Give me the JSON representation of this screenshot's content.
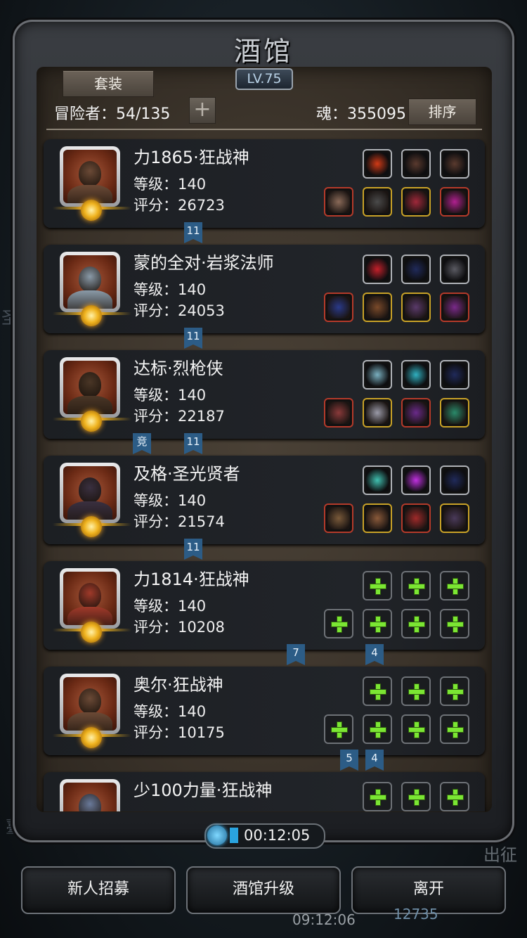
{
  "title": "酒馆",
  "level_badge": "LV.75",
  "suit_button": "套装",
  "adventurer_label": "冒险者：54/135",
  "add_button": "+",
  "soul_label": "魂：355095",
  "sort_button": "排序",
  "heroes": [
    {
      "name": "力1865·狂战神",
      "level": "等级：140",
      "score": "评分：26723",
      "face": "#6b4a36",
      "equip_top": [
        "#d13a16",
        "#5a3a2e",
        "#5a3a2e"
      ],
      "equip_bottom": [
        "#8a6a58",
        "#4a4a4a",
        "#a0283a",
        "#b02090"
      ],
      "borders_bottom": [
        "red",
        "gold",
        "gold",
        "red"
      ],
      "tags": [
        {
          "text": "11"
        }
      ]
    },
    {
      "name": "蒙的全对·岩浆法师",
      "level": "等级：140",
      "score": "评分：24053",
      "face": "#8a9aa8",
      "equip_top": [
        "#c4202a",
        "#202a5a",
        "#5a5a62"
      ],
      "equip_bottom": [
        "#2a3a8a",
        "#7a4a2a",
        "#5a3a6a",
        "#7a2a8a"
      ],
      "borders_bottom": [
        "red",
        "gold",
        "gold",
        "red"
      ],
      "tags": [
        {
          "text": "11"
        }
      ]
    },
    {
      "name": "达标·烈枪侠",
      "level": "等级：140",
      "score": "评分：22187",
      "face": "#4a3626",
      "equip_top": [
        "#7ab0c0",
        "#30b0c0",
        "#202a5a"
      ],
      "equip_bottom": [
        "#8a3a3a",
        "#9a9aa8",
        "#6a2a8a",
        "#2a8a6a"
      ],
      "borders_bottom": [
        "red",
        "gold",
        "red",
        "gold"
      ],
      "tags": [
        {
          "text": "竞"
        },
        {
          "text": "11"
        }
      ]
    },
    {
      "name": "及格·圣光贤者",
      "level": "等级：140",
      "score": "评分：21574",
      "face": "#3a3040",
      "equip_top": [
        "#40c0b0",
        "#c030e0",
        "#202a5a"
      ],
      "equip_bottom": [
        "#7a5a3a",
        "#8a5a3a",
        "#a02a2a",
        "#4a3a5a"
      ],
      "borders_bottom": [
        "red",
        "gold",
        "red",
        "gold"
      ],
      "tags": [
        {
          "text": "11"
        }
      ]
    },
    {
      "name": "力1814·狂战神",
      "level": "等级：140",
      "score": "评分：10208",
      "face": "#a03a2a",
      "tags": [
        {
          "text": "7"
        },
        {
          "text": "4"
        }
      ]
    },
    {
      "name": "奥尔·狂战神",
      "level": "等级：140",
      "score": "评分：10175",
      "face": "#6b4a36",
      "tags": [
        {
          "text": "5"
        },
        {
          "text": "4"
        }
      ]
    },
    {
      "name": "少100力量·狂战神",
      "level": "",
      "score": "",
      "face": "#6a7a9a"
    }
  ],
  "timer": "00:12:05",
  "recruit_button": "新人招募",
  "upgrade_button": "酒馆升级",
  "leave_button": "离开",
  "bottom_time": "09:12:06",
  "bottom_number": "12735",
  "bg_left_char_1": "圣",
  "bg_left_char_2": "薹",
  "bg_right_text": "出征",
  "icons": [
    "plus-icon",
    "timer-icon",
    "equipment-slot-icon",
    "hero-emblem-icon"
  ],
  "colors": {
    "tag": "#2c5c86",
    "plus": "#7be633",
    "parchment": "#3c342b"
  }
}
